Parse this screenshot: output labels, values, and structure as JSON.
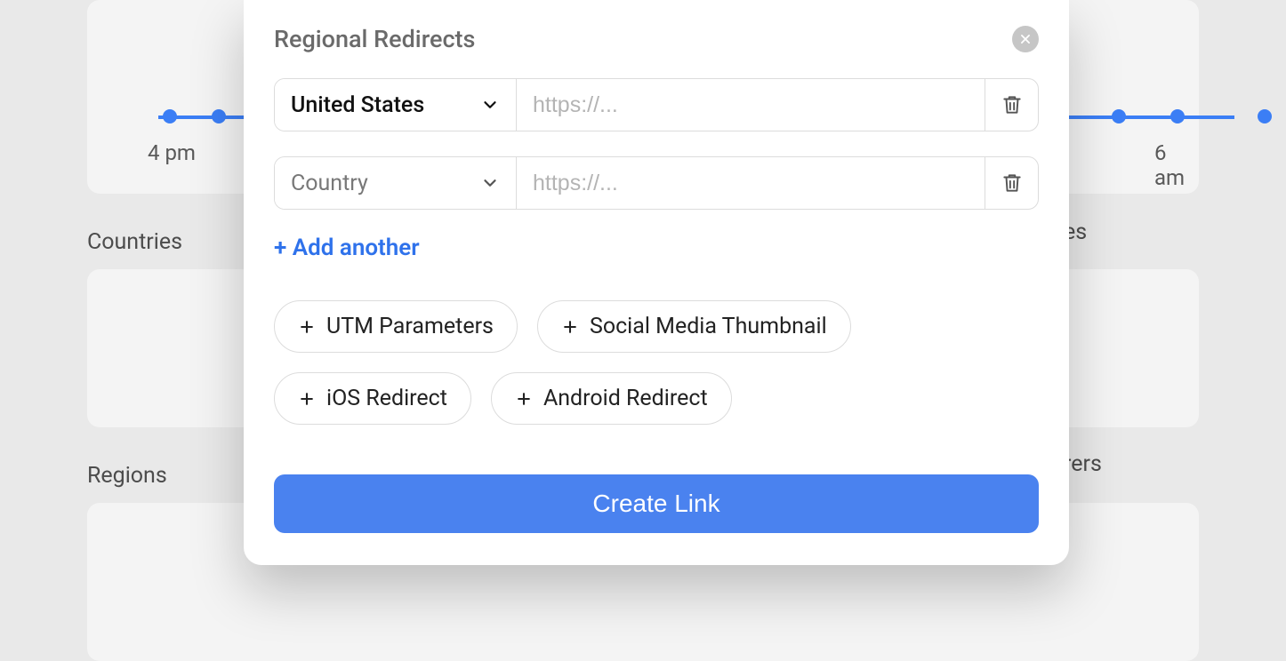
{
  "modal": {
    "title": "Regional Redirects",
    "rows": [
      {
        "country": "United States",
        "isPlaceholder": false,
        "url": "",
        "placeholder": "https://..."
      },
      {
        "country": "Country",
        "isPlaceholder": true,
        "url": "",
        "placeholder": "https://..."
      }
    ],
    "add_another": "+ Add another",
    "pills": [
      "UTM Parameters",
      "Social Media Thumbnail",
      "iOS Redirect",
      "Android Redirect"
    ],
    "submit": "Create Link"
  },
  "background": {
    "chart_labels": [
      "4 pm",
      "6 am"
    ],
    "sections": [
      "Countries",
      "Regions"
    ],
    "peek_labels": [
      "es",
      "rers"
    ]
  }
}
